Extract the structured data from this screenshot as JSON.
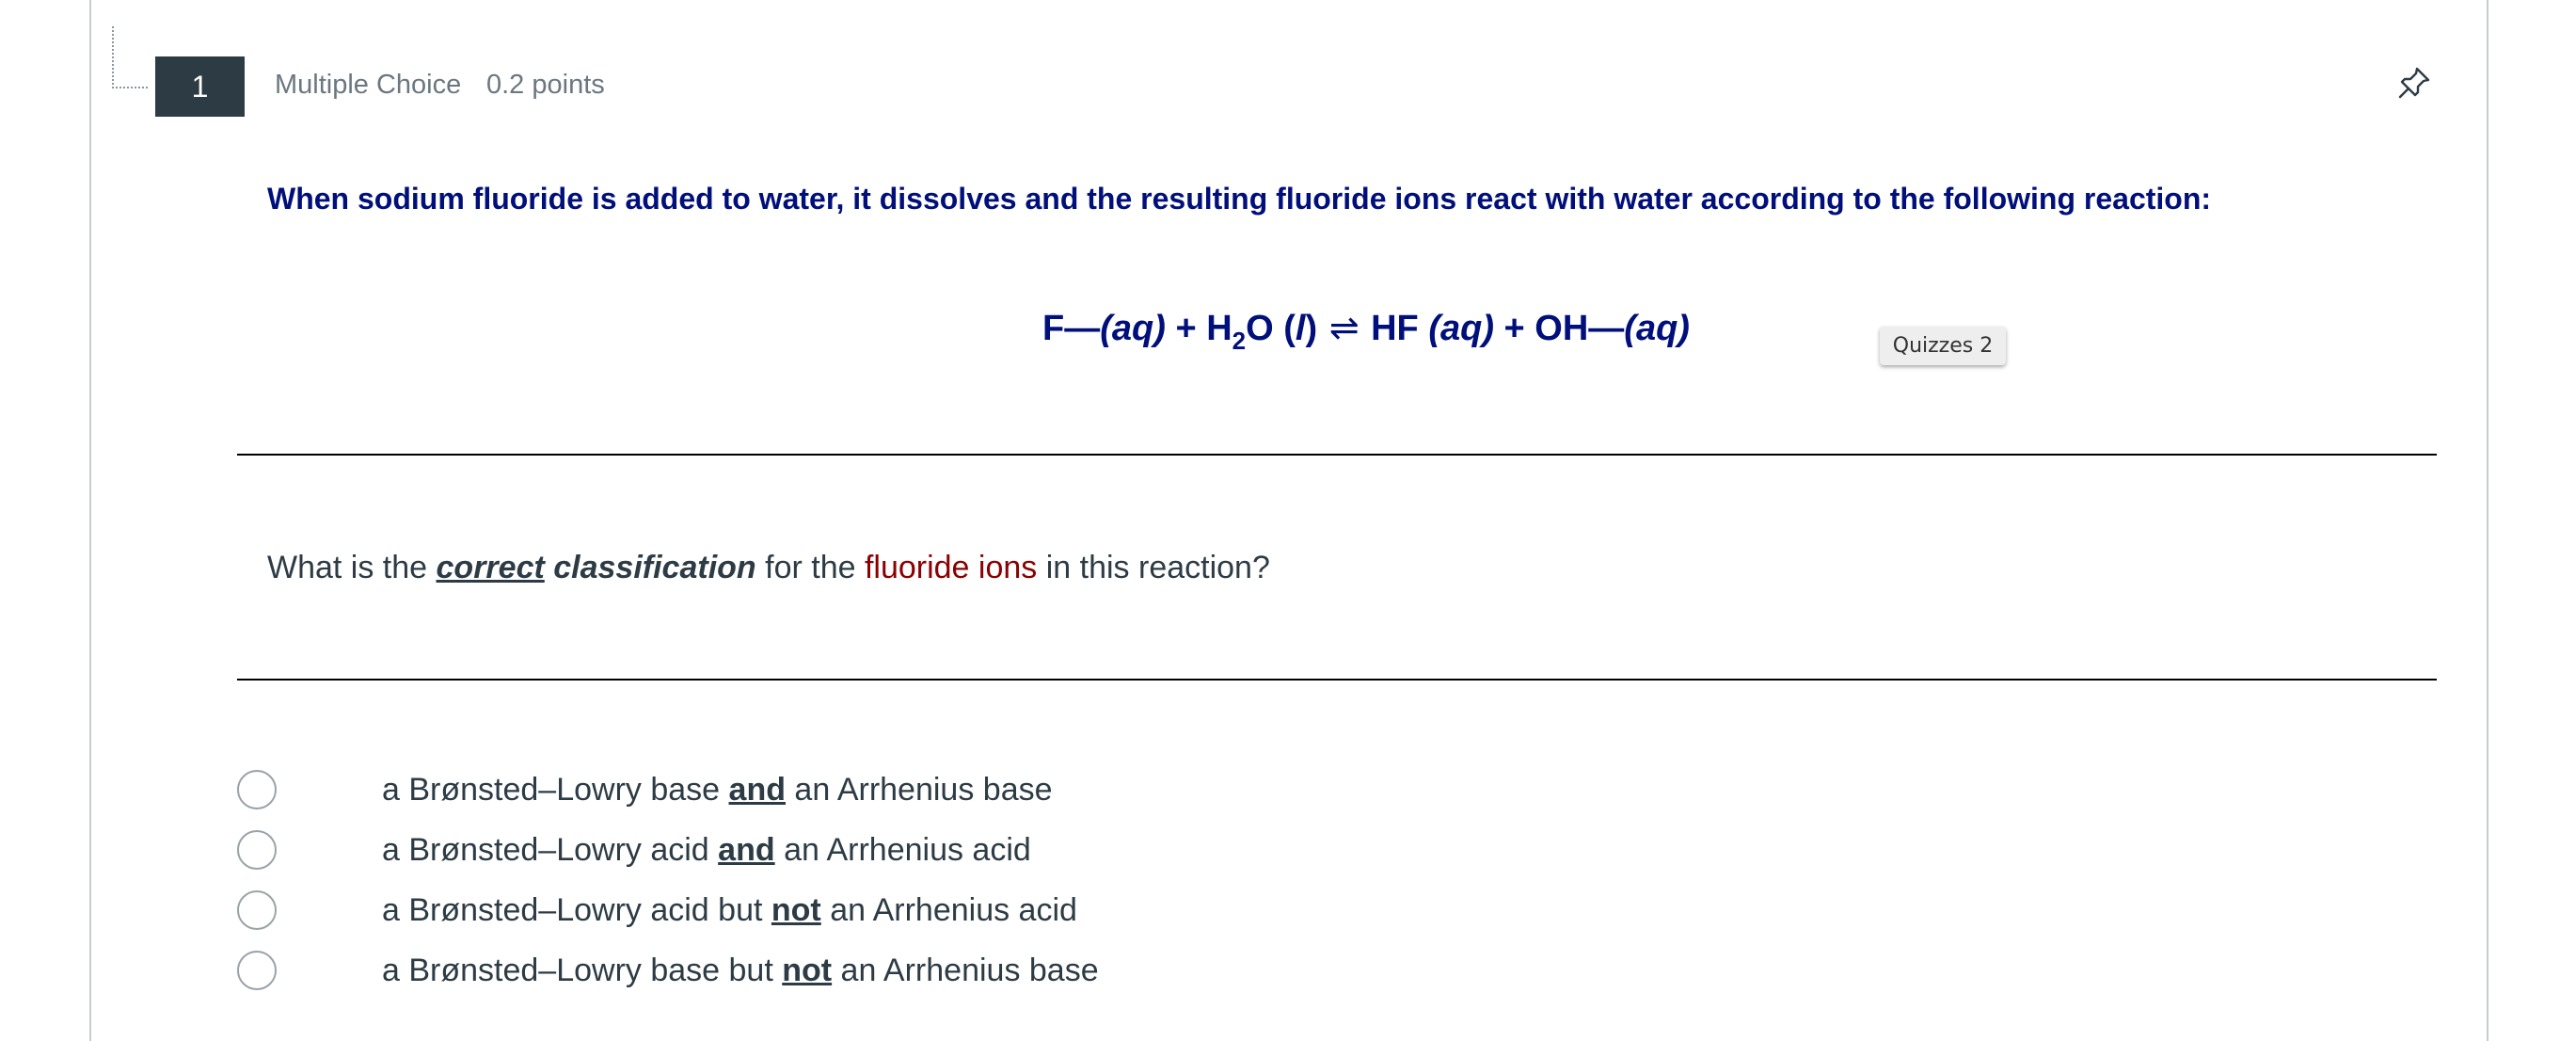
{
  "question": {
    "number": "1",
    "type": "Multiple Choice",
    "points": "0.2 points",
    "intro": "When sodium fluoride is added to water, it dissolves and the resulting fluoride ions react with water according to the following reaction:",
    "equation": {
      "f_ion": "F",
      "minus_sign": "—",
      "state_aq": "(aq)",
      "plus": "+",
      "water_h": "H",
      "water_sub": "2",
      "water_o": "O",
      "state_l_open": "(",
      "state_l": "l",
      "state_l_close": ")",
      "equilibrium_arrow": "⇌",
      "hf": "HF",
      "oh": "OH"
    },
    "prompt": {
      "part1": "What is the ",
      "correct": "correct",
      "space": " ",
      "classification": "classification",
      "part2": " for the ",
      "fluoride_ions": "fluoride ions",
      "part3": " in this reaction?"
    }
  },
  "tooltip": "Quizzes 2",
  "answers": [
    {
      "pre": "a Brønsted–Lowry base ",
      "emph": "and",
      "post": " an Arrhenius base",
      "selected": false
    },
    {
      "pre": "a Brønsted–Lowry acid ",
      "emph": "and",
      "post": " an Arrhenius acid",
      "selected": false
    },
    {
      "pre": "a Brønsted–Lowry acid but ",
      "emph": "not",
      "post": " an Arrhenius acid",
      "selected": false
    },
    {
      "pre": "a Brønsted–Lowry base but ",
      "emph": "not",
      "post": " an Arrhenius base",
      "selected": false
    }
  ],
  "icons": {
    "pin": "pin-icon"
  },
  "colors": {
    "question_text": "#000f7a",
    "highlight": "#8b0000",
    "number_badge": "#2d3b45",
    "meta_text": "#6b7780"
  }
}
